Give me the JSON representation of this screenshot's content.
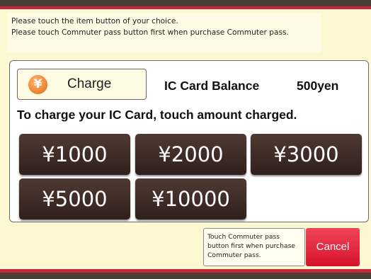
{
  "instructions": {
    "line1": "Please touch the item button of your choice.",
    "line2": "Please touch Commuter pass button first when purchase Commuter pass."
  },
  "charge": {
    "icon": "yen-coin-icon",
    "icon_glyph": "¥",
    "label": "Charge"
  },
  "balance": {
    "label": "IC Card Balance",
    "value": "500yen"
  },
  "prompt": "To charge your IC Card, touch amount charged.",
  "amounts": [
    "¥1000",
    "¥2000",
    "¥3000",
    "¥5000",
    "¥10000"
  ],
  "footer": {
    "note_lines": [
      "Touch Commuter pass",
      "button first when purchase",
      "Commuter pass."
    ],
    "cancel_label": "Cancel"
  },
  "colors": {
    "background": "#fdf8d2",
    "accent_red": "#c4283a",
    "dark_brown": "#4a3e39",
    "amount_button": "#3d2b25",
    "cancel_button": "#e02a40",
    "yen_icon": "#f28a3a"
  }
}
